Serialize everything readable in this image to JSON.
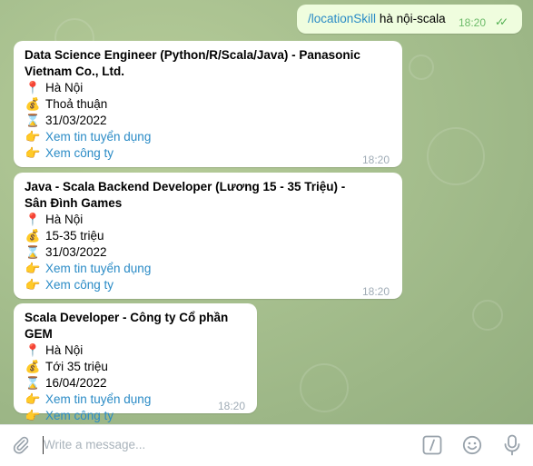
{
  "outgoing": {
    "command": "/locationSkill",
    "args": "hà nội-scala",
    "time": "18:20",
    "ticks": "✓✓"
  },
  "messages": [
    {
      "title": "Data Science Engineer (Python/R/Scala/Java) - Panasonic Vietnam Co., Ltd.",
      "location": "Hà Nội",
      "salary": "Thoả thuận",
      "deadline": "31/03/2022",
      "link_job": "Xem tin tuyển dụng",
      "link_company": "Xem công ty",
      "time": "18:20"
    },
    {
      "title": "Java - Scala Backend Developer (Lương 15 - 35 Triệu) - Sân Đình Games",
      "location": "Hà Nội",
      "salary": "15-35 triệu",
      "deadline": "31/03/2022",
      "link_job": "Xem tin tuyển dụng",
      "link_company": "Xem công ty",
      "time": "18:20"
    },
    {
      "title": "Scala Developer - Công ty Cổ phần GEM",
      "location": "Hà Nội",
      "salary": "Tới 35 triệu",
      "deadline": "16/04/2022",
      "link_job": "Xem tin tuyển dụng",
      "link_company": "Xem công ty",
      "time": "18:20"
    }
  ],
  "icons": {
    "location": "📍",
    "salary": "💰",
    "deadline": "⌛",
    "pointer": "👉",
    "attach": "paperclip-icon",
    "command": "command-icon",
    "emoji": "emoji-icon",
    "mic": "microphone-icon"
  },
  "composer": {
    "placeholder": "Write a message..."
  },
  "colors": {
    "link": "#2a8bc6",
    "outgoing_bubble": "#effdde",
    "incoming_bubble": "#ffffff"
  }
}
